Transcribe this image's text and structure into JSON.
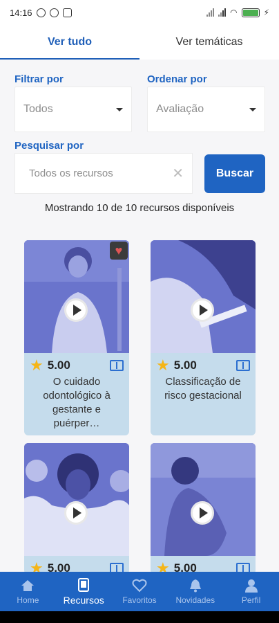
{
  "status": {
    "time": "14:16",
    "battery": "100"
  },
  "tabs": [
    {
      "label": "Ver tudo",
      "active": true
    },
    {
      "label": "Ver temáticas",
      "active": false
    }
  ],
  "filter": {
    "label": "Filtrar por",
    "value": "Todos"
  },
  "order": {
    "label": "Ordenar por",
    "value": "Avaliação"
  },
  "search": {
    "label": "Pesquisar por",
    "placeholder": "Todos os recursos",
    "button": "Buscar"
  },
  "showing": "Mostrando 10 de 10 recursos disponíveis",
  "cards": [
    {
      "rating": "5.00",
      "title": "O cuidado odontológico à gestante e puérper…",
      "favorite": true
    },
    {
      "rating": "5.00",
      "title": "Classificação de risco gestacional",
      "favorite": false
    },
    {
      "rating": "5.00",
      "title": "",
      "favorite": false
    },
    {
      "rating": "5.00",
      "title": "",
      "favorite": false
    }
  ],
  "nav": [
    {
      "label": "Home",
      "icon": "home-icon"
    },
    {
      "label": "Recursos",
      "icon": "tablet-icon",
      "active": true
    },
    {
      "label": "Favoritos",
      "icon": "heart-icon"
    },
    {
      "label": "Novidades",
      "icon": "bell-icon"
    },
    {
      "label": "Perfil",
      "icon": "person-icon"
    }
  ],
  "colors": {
    "primary": "#1f64c2",
    "card_bg": "#c5dcec",
    "image_tint": "#6670c9"
  }
}
